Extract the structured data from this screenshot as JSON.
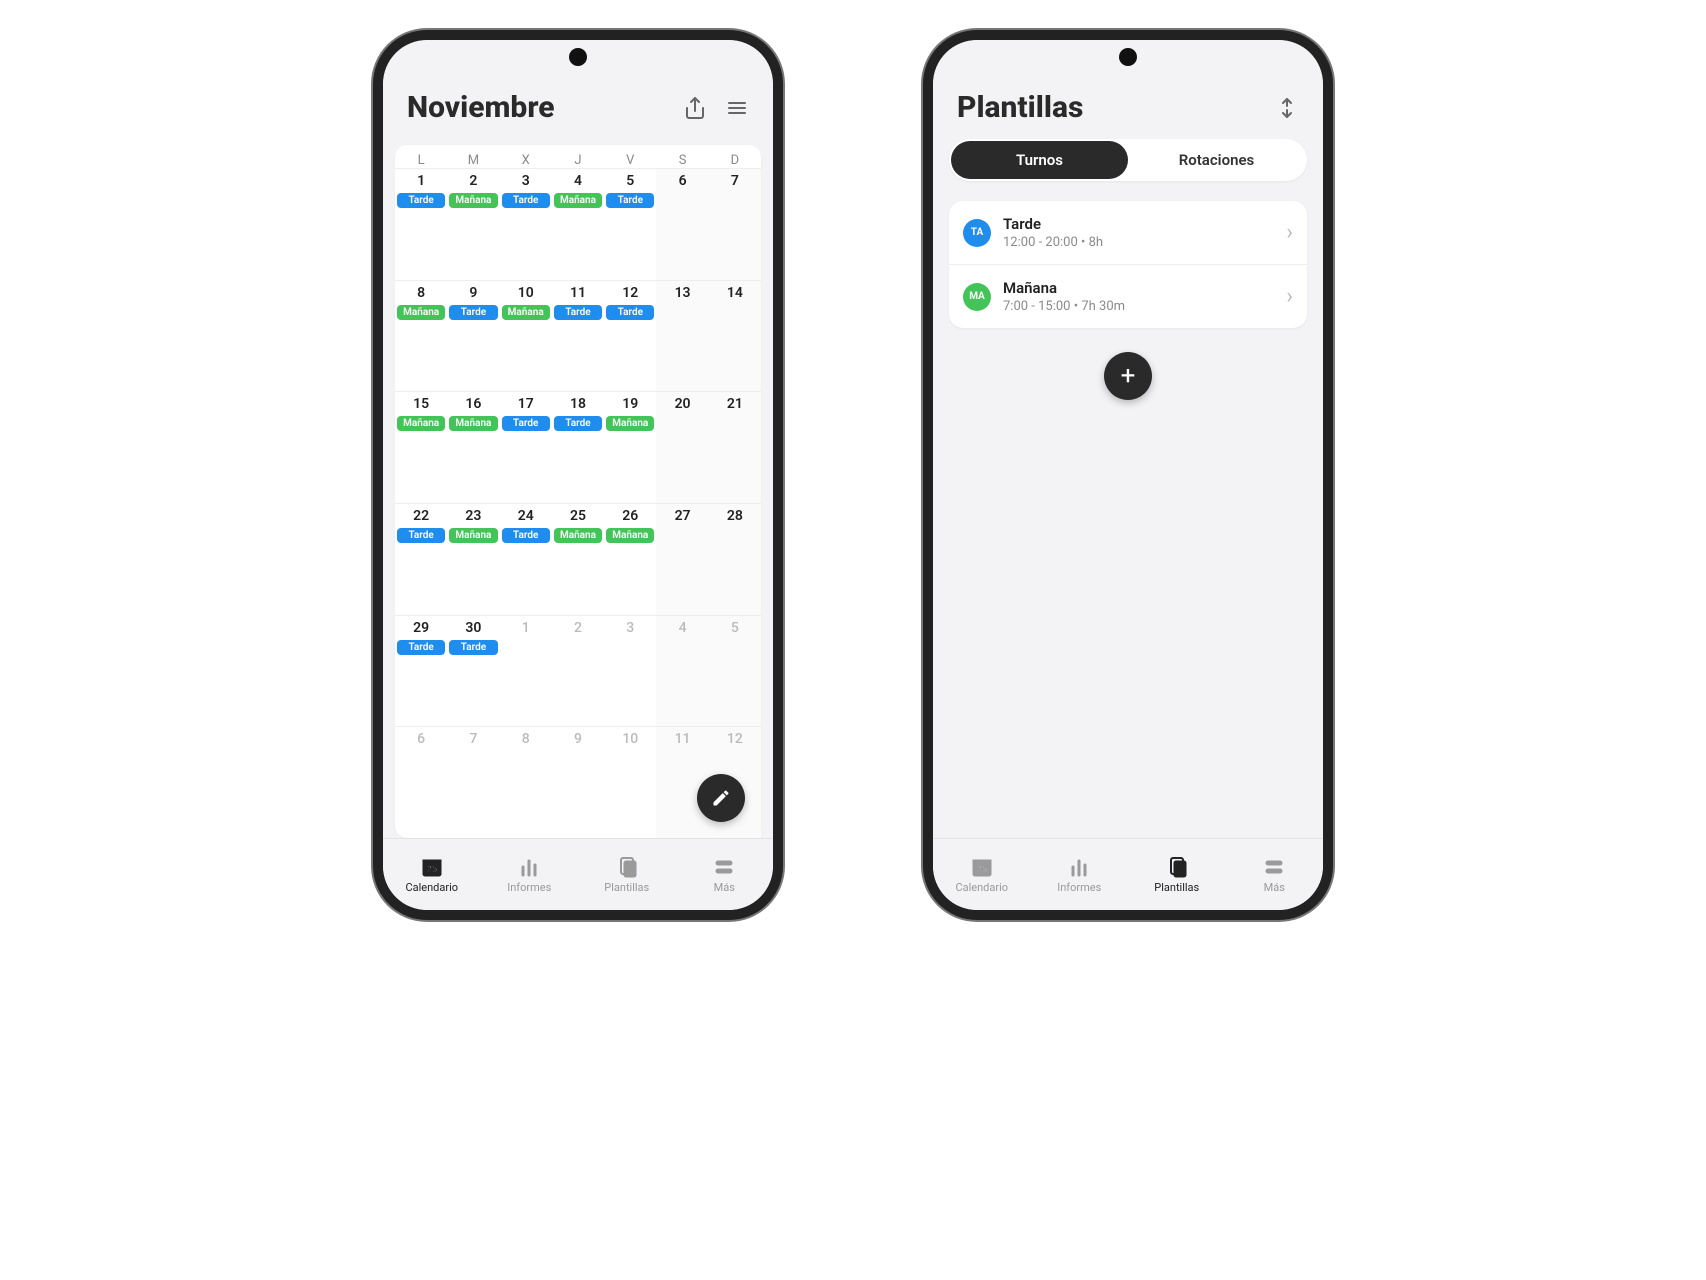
{
  "phone1": {
    "header": {
      "title": "Noviembre"
    },
    "dow": [
      "L",
      "M",
      "X",
      "J",
      "V",
      "S",
      "D"
    ],
    "bottom": {
      "calendario": "Calendario",
      "informes": "Informes",
      "plantillas": "Plantillas",
      "mas": "Más"
    },
    "weeks": [
      [
        {
          "num": "1",
          "shift": "Tarde",
          "color": "tarde"
        },
        {
          "num": "2",
          "shift": "Mañana",
          "color": "manana"
        },
        {
          "num": "3",
          "shift": "Tarde",
          "color": "tarde"
        },
        {
          "num": "4",
          "shift": "Mañana",
          "color": "manana"
        },
        {
          "num": "5",
          "shift": "Tarde",
          "color": "tarde"
        },
        {
          "num": "6",
          "shift": null,
          "weekend": true
        },
        {
          "num": "7",
          "shift": null,
          "weekend": true
        }
      ],
      [
        {
          "num": "8",
          "shift": "Mañana",
          "color": "manana"
        },
        {
          "num": "9",
          "shift": "Tarde",
          "color": "tarde"
        },
        {
          "num": "10",
          "shift": "Mañana",
          "color": "manana"
        },
        {
          "num": "11",
          "shift": "Tarde",
          "color": "tarde"
        },
        {
          "num": "12",
          "shift": "Tarde",
          "color": "tarde"
        },
        {
          "num": "13",
          "shift": null,
          "weekend": true
        },
        {
          "num": "14",
          "shift": null,
          "weekend": true
        }
      ],
      [
        {
          "num": "15",
          "shift": "Mañana",
          "color": "manana"
        },
        {
          "num": "16",
          "shift": "Mañana",
          "color": "manana"
        },
        {
          "num": "17",
          "shift": "Tarde",
          "color": "tarde"
        },
        {
          "num": "18",
          "shift": "Tarde",
          "color": "tarde"
        },
        {
          "num": "19",
          "shift": "Mañana",
          "color": "manana"
        },
        {
          "num": "20",
          "shift": null,
          "weekend": true
        },
        {
          "num": "21",
          "shift": null,
          "weekend": true
        }
      ],
      [
        {
          "num": "22",
          "shift": "Tarde",
          "color": "tarde"
        },
        {
          "num": "23",
          "shift": "Mañana",
          "color": "manana"
        },
        {
          "num": "24",
          "shift": "Tarde",
          "color": "tarde"
        },
        {
          "num": "25",
          "shift": "Mañana",
          "color": "manana"
        },
        {
          "num": "26",
          "shift": "Mañana",
          "color": "manana"
        },
        {
          "num": "27",
          "shift": null,
          "weekend": true
        },
        {
          "num": "28",
          "shift": null,
          "weekend": true
        }
      ],
      [
        {
          "num": "29",
          "shift": "Tarde",
          "color": "tarde"
        },
        {
          "num": "30",
          "shift": "Tarde",
          "color": "tarde"
        },
        {
          "num": "1",
          "shift": null,
          "muted": true
        },
        {
          "num": "2",
          "shift": null,
          "muted": true
        },
        {
          "num": "3",
          "shift": null,
          "muted": true
        },
        {
          "num": "4",
          "shift": null,
          "muted": true,
          "weekend": true
        },
        {
          "num": "5",
          "shift": null,
          "muted": true,
          "weekend": true
        }
      ],
      [
        {
          "num": "6",
          "shift": null,
          "muted": true
        },
        {
          "num": "7",
          "shift": null,
          "muted": true
        },
        {
          "num": "8",
          "shift": null,
          "muted": true
        },
        {
          "num": "9",
          "shift": null,
          "muted": true
        },
        {
          "num": "10",
          "shift": null,
          "muted": true
        },
        {
          "num": "11",
          "shift": null,
          "muted": true,
          "weekend": true
        },
        {
          "num": "12",
          "shift": null,
          "muted": true,
          "weekend": true
        }
      ]
    ]
  },
  "phone2": {
    "header": {
      "title": "Plantillas"
    },
    "segment": {
      "option1": "Turnos",
      "option2": "Rotaciones"
    },
    "templates": [
      {
        "badge": "TA",
        "badgeClass": "b-blue",
        "title": "Tarde",
        "subtitle": "12:00 - 20:00 • 8h"
      },
      {
        "badge": "MA",
        "badgeClass": "b-green",
        "title": "Mañana",
        "subtitle": "7:00 - 15:00 • 7h 30m"
      }
    ],
    "bottom": {
      "calendario": "Calendario",
      "informes": "Informes",
      "plantillas": "Plantillas",
      "mas": "Más"
    }
  }
}
